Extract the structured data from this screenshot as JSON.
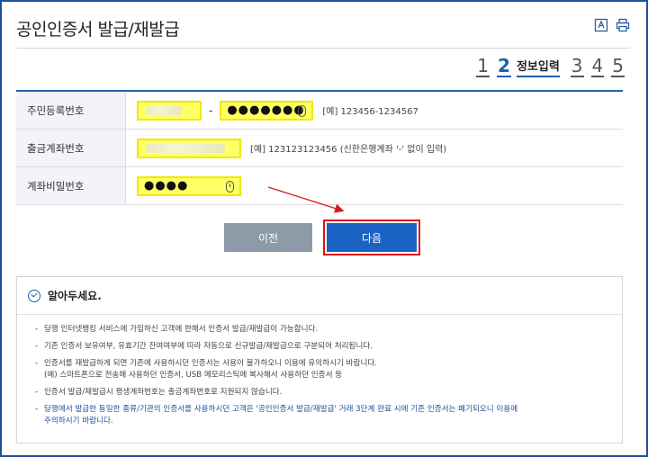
{
  "header": {
    "title": "공인인증서 발급/재발급"
  },
  "steps": {
    "items": [
      "1",
      "2",
      "3",
      "4",
      "5"
    ],
    "active_label": "정보입력"
  },
  "form": {
    "rows": [
      {
        "label": "주민등록번호",
        "masked": "●●●●●●●",
        "hint": "[예] 123456-1234567"
      },
      {
        "label": "출금계좌번호",
        "hint": "[예] 123123123456 (신한은행계좌 '-' 없이 입력)"
      },
      {
        "label": "계좌비밀번호",
        "masked": "●●●●"
      }
    ],
    "dash": "-"
  },
  "buttons": {
    "prev_label": "이전",
    "next_label": "다음"
  },
  "notice": {
    "title": "알아두세요.",
    "items": [
      "당행 인터넷뱅킹 서비스에 가입하신 고객에 한해서 인증서 발급/재발급이 가능합니다.",
      "기존 인증서 보유여부, 유효기간 잔여여부에 따라 자동으로 신규발급/재발급으로 구분되어 처리됩니다.",
      "인증서를 재발급하게 되면 기존에 사용하시던 인증서는 사용이 불가하오니 이용에 유의하시기 바랍니다.",
      "(예) 스마트폰으로 전송해 사용하던 인증서, USB 메모리스틱에 복사해서 사용하던 인증서 등",
      "인증서 발급/재발급시 평생계좌번호는 출금계좌번호로 지원되지 않습니다.",
      "당행에서 발급한 동일한 종류/기관의 인증서를 사용하시던 고객은 '공인인증서 발급/재발급' 거래 3단계 완료 시에 기존 인증서는 폐기되오니 이용에",
      "주의하시기 바랍니다."
    ]
  },
  "colors": {
    "accent": "#1a5fb4",
    "highlight": "#ffff66",
    "annotation": "#e01010"
  }
}
